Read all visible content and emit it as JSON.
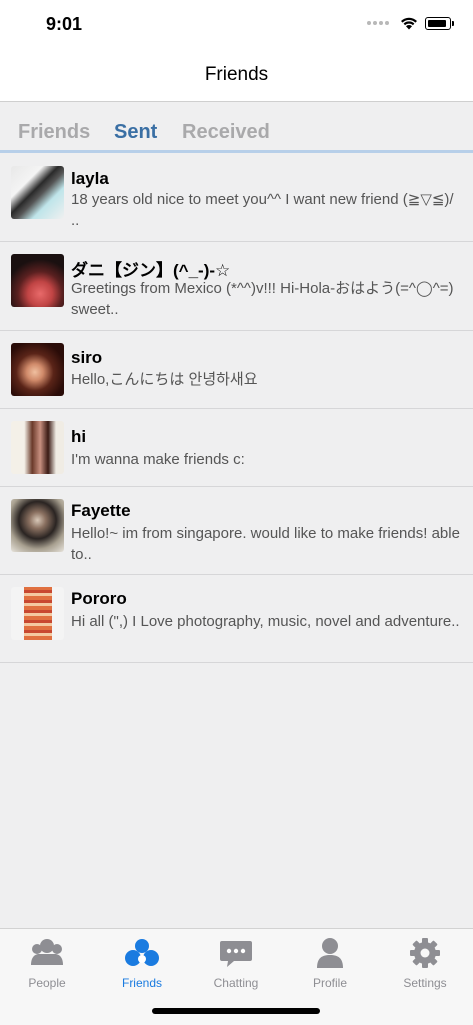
{
  "status": {
    "time": "9:01"
  },
  "nav": {
    "title": "Friends"
  },
  "segments": [
    "Friends",
    "Sent",
    "Received"
  ],
  "active_segment": "Sent",
  "requests": [
    {
      "name": "layla",
      "message": "18 years old nice to meet you^^ I want new friend (≧▽≦)/ .."
    },
    {
      "name": "ダニ【ジン】(^_-)-☆",
      "message": "Greetings from Mexico (*^^)v!!! Hi-Hola-おはよう(=^◯^=) sweet.."
    },
    {
      "name": "siro",
      "message": "Hello,こんにちは 안녕하새요"
    },
    {
      "name": "hi",
      "message": "I'm wanna make friends c:"
    },
    {
      "name": "Fayette",
      "message": "Hello!~ im from singapore. would like to make friends! able to.."
    },
    {
      "name": "Pororo",
      "message": "Hi all (\",) I Love photography, music, novel and adventure.."
    }
  ],
  "tabs": [
    {
      "label": "People",
      "icon": "people-icon"
    },
    {
      "label": "Friends",
      "icon": "friends-icon"
    },
    {
      "label": "Chatting",
      "icon": "chat-bubble-icon"
    },
    {
      "label": "Profile",
      "icon": "profile-icon"
    },
    {
      "label": "Settings",
      "icon": "gear-icon"
    }
  ],
  "active_tab": "Friends",
  "colors": {
    "accent": "#3a6fa4",
    "tab_active": "#1a7be0",
    "tab_inactive": "#8e8e93",
    "background": "#efeff0"
  }
}
